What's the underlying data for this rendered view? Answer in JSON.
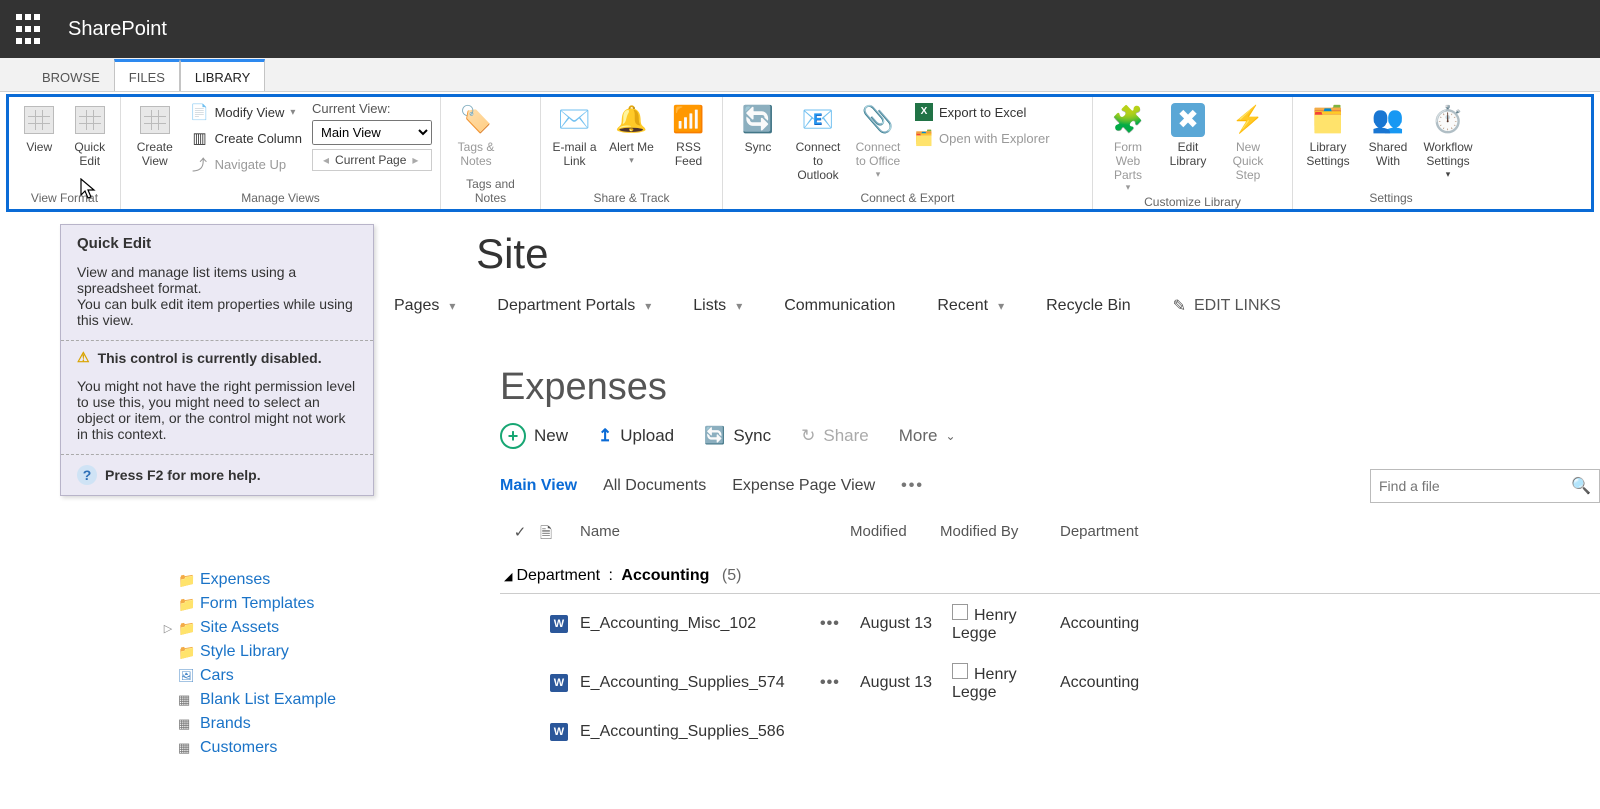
{
  "app": {
    "brand": "SharePoint"
  },
  "tabs": {
    "browse": "BROWSE",
    "files": "FILES",
    "library": "LIBRARY"
  },
  "ribbon": {
    "view_format": {
      "label": "View Format",
      "view": "View",
      "quick_edit": "Quick Edit"
    },
    "manage_views": {
      "label": "Manage Views",
      "create_view": "Create View",
      "modify_view": "Modify View",
      "create_column": "Create Column",
      "navigate_up": "Navigate Up",
      "current_view_label": "Current View:",
      "current_view_value": "Main View",
      "current_page": "Current Page"
    },
    "tags_notes": {
      "label": "Tags and Notes",
      "btn": "Tags & Notes"
    },
    "share_track": {
      "label": "Share & Track",
      "email": "E-mail a Link",
      "alert": "Alert Me",
      "rss": "RSS Feed"
    },
    "connect_export": {
      "label": "Connect & Export",
      "sync": "Sync",
      "outlook": "Connect to Outlook",
      "office": "Connect to Office",
      "excel": "Export to Excel",
      "explorer": "Open with Explorer"
    },
    "customize": {
      "label": "Customize Library",
      "form_web": "Form Web Parts",
      "edit_lib": "Edit Library",
      "quick_step": "New Quick Step"
    },
    "settings": {
      "label": "Settings",
      "lib_settings": "Library Settings",
      "shared_with": "Shared With",
      "workflow": "Workflow Settings"
    }
  },
  "tooltip": {
    "title": "Quick Edit",
    "desc1": "View and manage list items using a spreadsheet format.",
    "desc2": "You can bulk edit item properties while using this view.",
    "warn": "This control is currently disabled.",
    "warn_detail": "You might not have the right permission level to use this, you might need to select an object or item, or the control might not work in this context.",
    "help": "Press F2 for more help."
  },
  "site_title_suffix": "Site",
  "topnav": {
    "pages": "Pages",
    "portals": "Department Portals",
    "lists": "Lists",
    "comm": "Communication",
    "recent": "Recent",
    "recycle": "Recycle Bin",
    "edit_links": "EDIT LINKS"
  },
  "tree": [
    {
      "icon": "folder",
      "label": "Expenses"
    },
    {
      "icon": "folder",
      "label": "Form Templates"
    },
    {
      "icon": "folder",
      "label": "Site Assets",
      "expandable": true
    },
    {
      "icon": "folder",
      "label": "Style Library"
    },
    {
      "icon": "image",
      "label": "Cars"
    },
    {
      "icon": "list",
      "label": "Blank List Example"
    },
    {
      "icon": "list",
      "label": "Brands"
    },
    {
      "icon": "list",
      "label": "Customers"
    }
  ],
  "library": {
    "title": "Expenses",
    "toolbar": {
      "new": "New",
      "upload": "Upload",
      "sync": "Sync",
      "share": "Share",
      "more": "More"
    },
    "views": {
      "main": "Main View",
      "all": "All Documents",
      "expense": "Expense Page View"
    },
    "find_placeholder": "Find a file",
    "columns": {
      "name": "Name",
      "modified": "Modified",
      "modified_by": "Modified By",
      "department": "Department"
    },
    "group": {
      "field": "Department",
      "value": "Accounting",
      "count": "(5)"
    },
    "rows": [
      {
        "name": "E_Accounting_Misc_102",
        "modified": "August 13",
        "by": "Henry Legge",
        "dept": "Accounting"
      },
      {
        "name": "E_Accounting_Supplies_574",
        "modified": "August 13",
        "by": "Henry Legge",
        "dept": "Accounting"
      },
      {
        "name": "E_Accounting_Supplies_586",
        "modified": "",
        "by": "",
        "dept": ""
      }
    ]
  }
}
